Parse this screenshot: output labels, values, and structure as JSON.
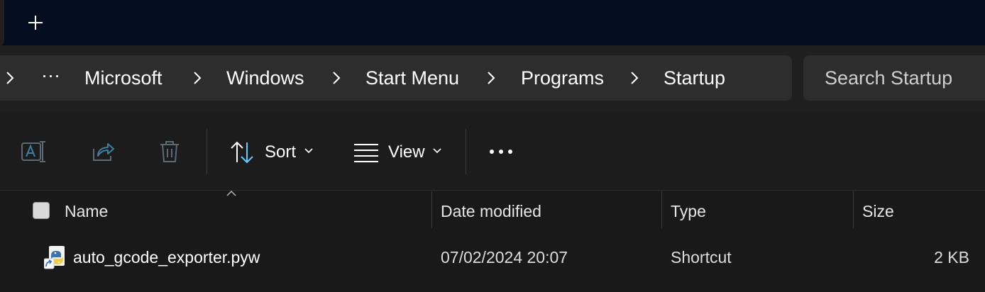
{
  "tabstrip": {
    "new_tab_label": "+"
  },
  "address": {
    "more_label": "···",
    "crumbs": [
      "Microsoft",
      "Windows",
      "Start Menu",
      "Programs",
      "Startup"
    ]
  },
  "search": {
    "placeholder": "Search Startup"
  },
  "toolbar": {
    "sort_label": "Sort",
    "view_label": "View",
    "icons": [
      "rename-icon",
      "share-icon",
      "delete-icon",
      "sort-icon",
      "view-icon",
      "more-icon"
    ]
  },
  "columns": {
    "name": "Name",
    "date_modified": "Date modified",
    "type": "Type",
    "size": "Size"
  },
  "files": [
    {
      "name": "auto_gcode_exporter.pyw",
      "date_modified": "07/02/2024 20:07",
      "type": "Shortcut",
      "size": "2 KB",
      "icon": "python-shortcut-icon"
    }
  ],
  "colors": {
    "tabstrip_bg": "#040c20",
    "panel_bg": "#2d2d2d",
    "window_bg": "#191919",
    "accent_blue": "#60cdff"
  }
}
